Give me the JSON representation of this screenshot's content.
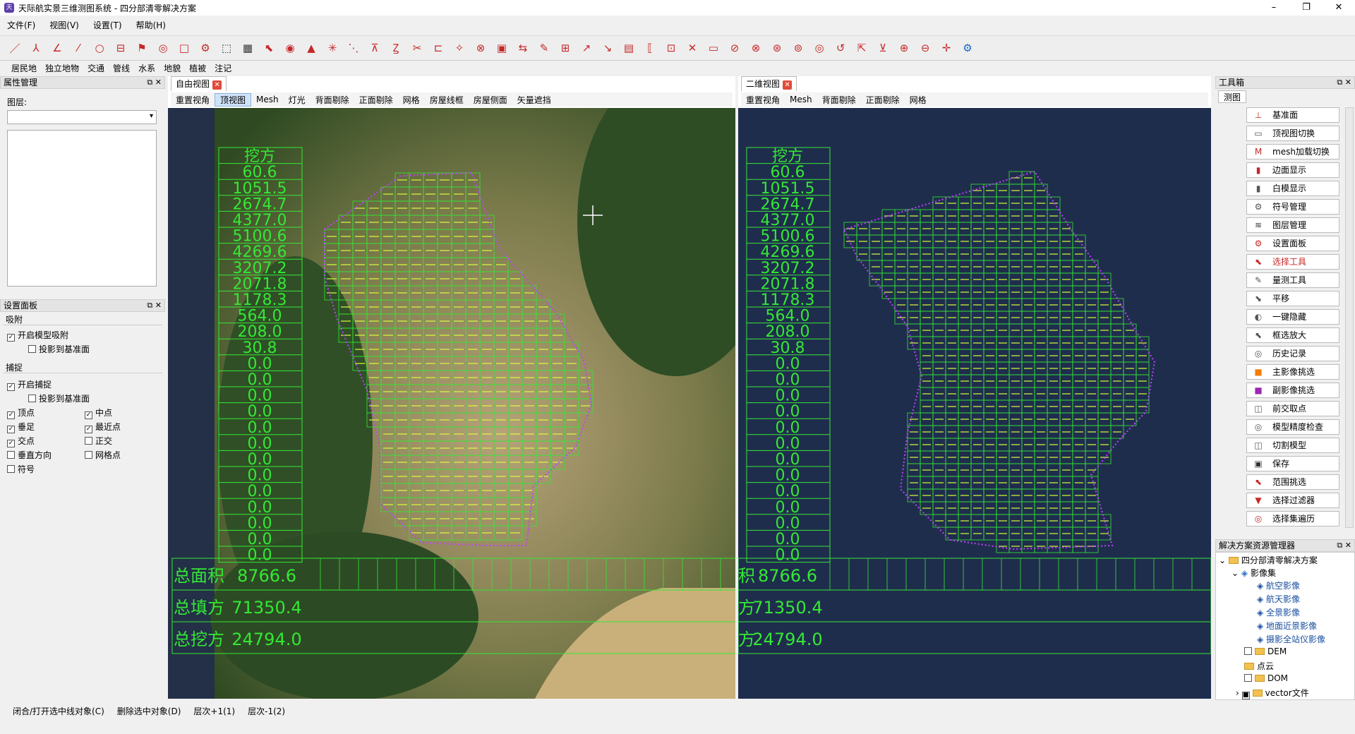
{
  "window": {
    "title": "天际航实景三维测图系统 - 四分部清零解决方案"
  },
  "menu": [
    "文件(F)",
    "视图(V)",
    "设置(T)",
    "帮助(H)"
  ],
  "layers_bar": [
    "居民地",
    "独立地物",
    "交通",
    "管线",
    "水系",
    "地貌",
    "植被",
    "注记"
  ],
  "attr_panel": {
    "title": "属性管理",
    "layer_label": "图层:"
  },
  "settings_panel": {
    "title": "设置面板",
    "adsorb_group": "吸附",
    "adsorb_enable": "开启模型吸附",
    "adsorb_project": "投影到基准面",
    "capture_group": "捕捉",
    "capture_enable": "开启捕捉",
    "capture_project": "投影到基准面",
    "vertex": "顶点",
    "midpoint": "中点",
    "foot": "垂足",
    "nearest": "最近点",
    "intersection": "交点",
    "orthogonal": "正交",
    "perpendicular": "垂直方向",
    "gridpoint": "网格点",
    "symbol": "符号"
  },
  "free_view": {
    "tab": "自由视图",
    "buttons": [
      "重置视角",
      "顶视图",
      "Mesh",
      "灯光",
      "背面剔除",
      "正面剔除",
      "网格",
      "房屋线框",
      "房屋侧面",
      "矢量遮挡"
    ]
  },
  "view2d": {
    "tab": "二维视图",
    "buttons": [
      "重置视角",
      "Mesh",
      "背面剔除",
      "正面剔除",
      "网格"
    ]
  },
  "table": {
    "header": "挖方",
    "values": [
      "60.6",
      "1051.5",
      "2674.7",
      "4377.0",
      "5100.6",
      "4269.6",
      "3207.2",
      "2071.8",
      "1178.3",
      "564.0",
      "208.0",
      "30.8",
      "0.0",
      "0.0",
      "0.0",
      "0.0",
      "0.0",
      "0.0",
      "0.0",
      "0.0",
      "0.0",
      "0.0",
      "0.0",
      "0.0",
      "0.0"
    ],
    "total_area_label": "总面积",
    "total_area": "8766.6",
    "total_fill_label": "总填方",
    "total_fill": "71350.4",
    "total_cut_label": "总挖方",
    "total_cut": "24794.0",
    "fill_header_partial": "填方",
    "fill_row_partial_label": "积",
    "fill_label_partial": "方",
    "cut_label_partial": "方"
  },
  "toolbox": {
    "title": "工具箱",
    "tab": "测图",
    "items": [
      "基准面",
      "顶视图切换",
      "mesh加载切换",
      "边面显示",
      "白模显示",
      "符号管理",
      "图层管理",
      "设置面板",
      "选择工具",
      "量测工具",
      "平移",
      "一键隐藏",
      "框选放大",
      "历史记录",
      "主影像挑选",
      "副影像挑选",
      "前交取点",
      "模型精度检查",
      "切割模型",
      "保存",
      "范围挑选",
      "选择过滤器",
      "选择集遍历"
    ]
  },
  "resource_tree": {
    "title": "解决方案资源管理器",
    "root": "四分部清零解决方案",
    "imagery": "影像集",
    "aerial": "航空影像",
    "space": "航天影像",
    "panorama": "全景影像",
    "ground": "地面近景影像",
    "total_station": "摄影全站仪影像",
    "dem": "DEM",
    "pointcloud": "点云",
    "dom": "DOM",
    "vector": "vector文件"
  },
  "status": [
    "闭合/打开选中线对象(C)",
    "删除选中对象(D)",
    "层次+1(1)",
    "层次-1(2)"
  ],
  "colors": {
    "grid": "#34e834",
    "bg2d": "#1f2d4d",
    "accent": "#e04a3a"
  }
}
